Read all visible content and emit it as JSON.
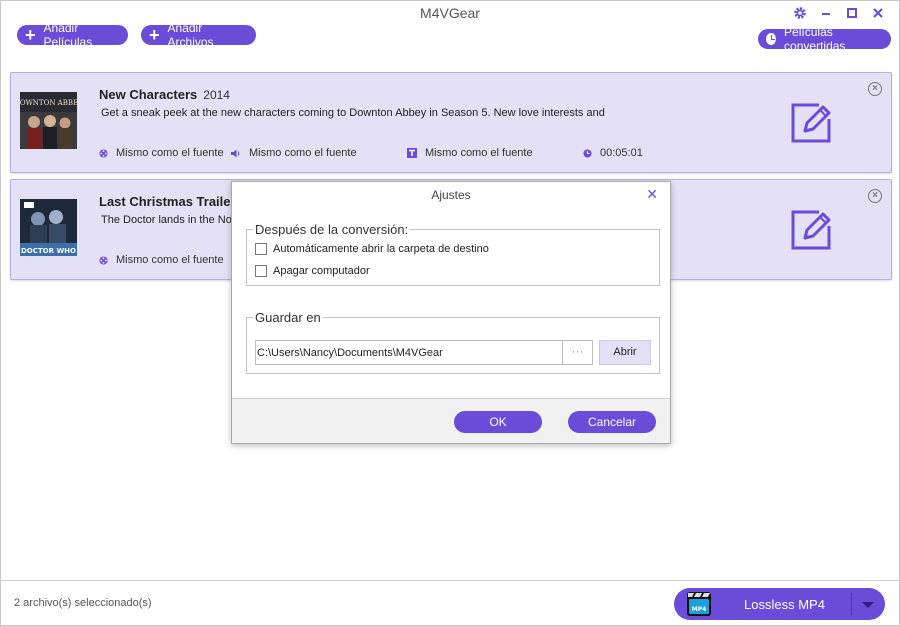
{
  "window": {
    "title": "M4VGear"
  },
  "toolbar": {
    "add_movies_label": "Añadir Películas",
    "add_files_label": "Añadir Archivos",
    "converted_label": "Películas convertidas"
  },
  "items": [
    {
      "title": "New Characters",
      "year": "2014",
      "description": "Get a sneak peek at the new characters coming to Downton Abbey in Season 5. New love interests and",
      "video": "Mismo como el fuente",
      "audio": "Mismo como el fuente",
      "subtitle": "Mismo como el fuente",
      "duration": "00:05:01",
      "thumb_label_top": "DOWNTON ABBEY"
    },
    {
      "title": "Last Christmas Trailer",
      "year": "",
      "description": "The Doctor lands in the Nor",
      "video": "Mismo como el fuente",
      "thumb_label_top": "DOCTOR WHO"
    }
  ],
  "dialog": {
    "title": "Ajustes",
    "after_conversion_legend": "Después de la conversión:",
    "open_folder_label": "Automáticamente abrir la carpeta de destino",
    "shutdown_label": "Apagar computador",
    "save_in_legend": "Guardar en",
    "path_value": "C:\\Users\\Nancy\\Documents\\M4VGear",
    "dots_label": "···",
    "open_button": "Abrir",
    "ok_button": "OK",
    "cancel_button": "Cancelar"
  },
  "status": {
    "selected_count": "2 archivo(s) seleccionado(s)",
    "output_format": "Lossless MP4",
    "format_icon_text": "MP4"
  },
  "colors": {
    "accent": "#6a4cd8",
    "item_bg": "#e4e0f6"
  }
}
